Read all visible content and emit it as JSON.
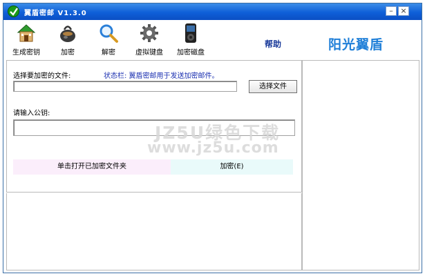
{
  "window": {
    "title": "翼盾密邮 V1.3.0",
    "minimize_glyph": "–",
    "close_glyph": "×"
  },
  "toolbar": {
    "items": [
      {
        "label": "生成密钥",
        "icon": "house-icon"
      },
      {
        "label": "加密",
        "icon": "lock-pot-icon"
      },
      {
        "label": "解密",
        "icon": "magnifier-icon"
      },
      {
        "label": "虚拟键盘",
        "icon": "gear-icon"
      },
      {
        "label": "加密磁盘",
        "icon": "ipod-icon"
      }
    ],
    "help_label": "帮助",
    "brand": "阳光翼盾"
  },
  "form": {
    "file_label": "选择要加密的文件:",
    "status_text": "状态栏: 翼盾密邮用于发送加密邮件。",
    "file_value": "",
    "choose_file_button": "选择文件",
    "pubkey_label": "请输入公钥:",
    "pubkey_value": "",
    "open_folder_button": "单击打开已加密文件夹",
    "encrypt_button": "加密(E)"
  },
  "watermark": {
    "line1": "JZ5U绿色下载",
    "line2": "www.jz5u.com"
  },
  "colors": {
    "titlebar": "#0e5fd8",
    "status_text": "#1a2fb0",
    "brand": "#1f7fd8",
    "pink_button": "#fbeefb",
    "cyan_button": "#e9fafa"
  }
}
